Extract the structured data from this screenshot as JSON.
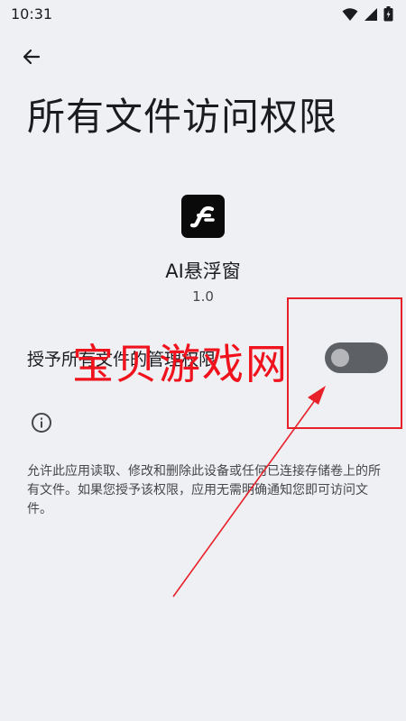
{
  "status_bar": {
    "time": "10:31",
    "icons": [
      "wifi-icon",
      "signal-icon",
      "battery-icon"
    ]
  },
  "header": {
    "back_icon": "arrow-back-icon",
    "title": "所有文件访问权限"
  },
  "app": {
    "name": "AI悬浮窗",
    "version": "1.0",
    "icon": "app-logo-icon"
  },
  "permission": {
    "label": "授予所有文件的管理权限",
    "enabled": false
  },
  "info": {
    "icon": "info-icon",
    "description": "允许此应用读取、修改和删除此设备或任何已连接存储卷上的所有文件。如果您授予该权限，应用无需明确通知您即可访问文件。"
  },
  "overlay": {
    "watermark": "宝贝游戏网",
    "accent_color": "#e8202a"
  }
}
